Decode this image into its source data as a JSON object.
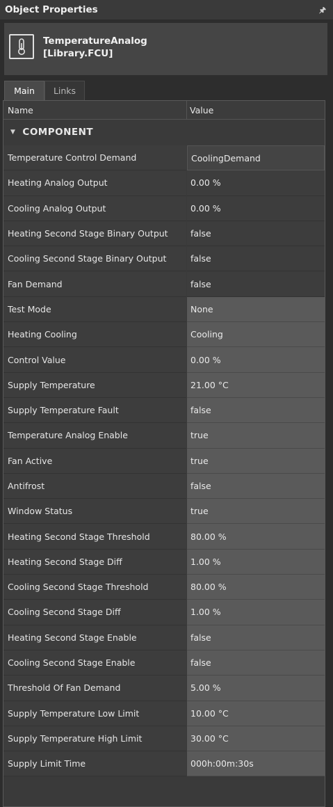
{
  "panel": {
    "title": "Object Properties",
    "pin_icon": "pin-icon"
  },
  "object": {
    "name_line1": "TemperatureAnalog",
    "name_line2": "[Library.FCU]",
    "icon": "thermometer-icon"
  },
  "tabs": [
    {
      "label": "Main",
      "active": true
    },
    {
      "label": "Links",
      "active": false
    }
  ],
  "grid": {
    "columns": [
      "Name",
      "Value"
    ],
    "category": "COMPONENT",
    "rows": [
      {
        "name": "Temperature Control Demand",
        "value": "CoolingDemand"
      },
      {
        "name": "Heating Analog Output",
        "value": "0.00 %"
      },
      {
        "name": "Cooling Analog Output",
        "value": "0.00 %"
      },
      {
        "name": "Heating Second Stage Binary Output",
        "value": "false"
      },
      {
        "name": "Cooling Second Stage Binary Output",
        "value": "false"
      },
      {
        "name": "Fan Demand",
        "value": "false"
      },
      {
        "name": "Test Mode",
        "value": "None"
      },
      {
        "name": "Heating Cooling",
        "value": "Cooling"
      },
      {
        "name": "Control Value",
        "value": "0.00 %"
      },
      {
        "name": "Supply Temperature",
        "value": "21.00 °C"
      },
      {
        "name": "Supply Temperature Fault",
        "value": "false"
      },
      {
        "name": "Temperature Analog Enable",
        "value": "true"
      },
      {
        "name": "Fan Active",
        "value": "true"
      },
      {
        "name": "Antifrost",
        "value": "false"
      },
      {
        "name": "Window Status",
        "value": "true"
      },
      {
        "name": "Heating Second Stage Threshold",
        "value": "80.00 %"
      },
      {
        "name": "Heating Second Stage Diff",
        "value": "1.00 %"
      },
      {
        "name": "Cooling Second Stage Threshold",
        "value": "80.00 %"
      },
      {
        "name": "Cooling Second Stage Diff",
        "value": "1.00 %"
      },
      {
        "name": "Heating Second Stage Enable",
        "value": "false"
      },
      {
        "name": "Cooling Second Stage Enable",
        "value": "false"
      },
      {
        "name": "Threshold Of Fan Demand",
        "value": "5.00 %"
      },
      {
        "name": "Supply Temperature Low Limit",
        "value": "10.00 °C"
      },
      {
        "name": "Supply Temperature High Limit",
        "value": "30.00 °C"
      },
      {
        "name": "Supply Limit Time",
        "value": "000h:00m:30s"
      }
    ]
  }
}
